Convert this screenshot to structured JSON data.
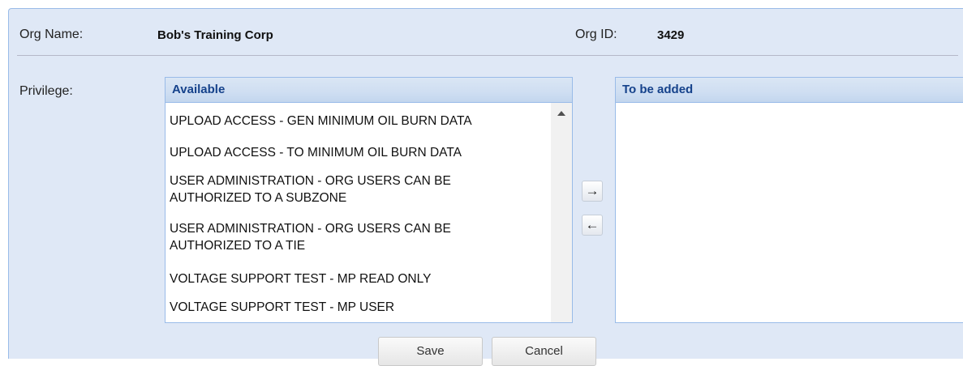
{
  "org": {
    "name_label": "Org Name:",
    "name_value": "Bob's Training Corp",
    "id_label": "Org ID:",
    "id_value": "3429"
  },
  "privilege": {
    "label": "Privilege:",
    "available": {
      "header": "Available",
      "items": [
        [
          "UPLOAD ACCESS - GEN MINIMUM OIL BURN DATA"
        ],
        [
          "UPLOAD ACCESS - TO MINIMUM OIL BURN DATA"
        ],
        [
          "USER ADMINISTRATION - ORG USERS CAN BE",
          "AUTHORIZED TO A SUBZONE"
        ],
        [
          "USER ADMINISTRATION - ORG USERS CAN BE",
          "AUTHORIZED TO A TIE"
        ],
        [
          "VOLTAGE SUPPORT TEST - MP READ ONLY"
        ],
        [
          "VOLTAGE SUPPORT TEST - MP USER"
        ]
      ]
    },
    "to_be_added": {
      "header": "To be added",
      "items": []
    },
    "add_icon": "→",
    "remove_icon": "←"
  },
  "buttons": {
    "save": "Save",
    "cancel": "Cancel"
  }
}
